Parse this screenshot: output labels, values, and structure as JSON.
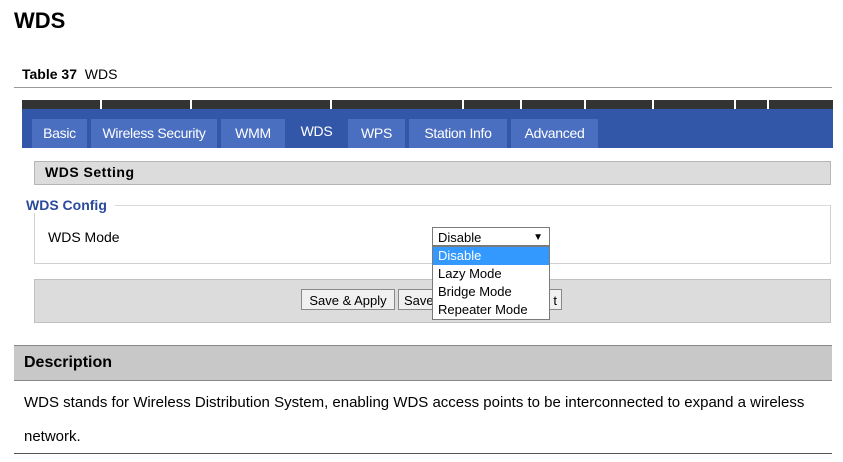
{
  "heading": "WDS",
  "caption": {
    "label": "Table 37",
    "title": "WDS"
  },
  "tabs": [
    {
      "label": "Basic",
      "active": false
    },
    {
      "label": "Wireless Security",
      "active": false
    },
    {
      "label": "WMM",
      "active": false
    },
    {
      "label": "WDS",
      "active": true
    },
    {
      "label": "WPS",
      "active": false
    },
    {
      "label": "Station Info",
      "active": false
    },
    {
      "label": "Advanced",
      "active": false
    }
  ],
  "section_title": "WDS Setting",
  "config": {
    "legend": "WDS Config",
    "mode_label": "WDS Mode",
    "mode_value": "Disable",
    "options": [
      "Disable",
      "Lazy Mode",
      "Bridge Mode",
      "Repeater Mode"
    ]
  },
  "buttons": {
    "save_apply": "Save & Apply",
    "save": "Save",
    "cancel_tail": "t"
  },
  "description": {
    "header": "Description",
    "text": "WDS stands for Wireless Distribution System, enabling WDS access points to be interconnected to expand a wireless network."
  },
  "colors": {
    "tab_bar": "#3257a8",
    "tab": "#4a6ec0",
    "legend": "#2a4a9c",
    "selected_option": "#3399ff"
  }
}
